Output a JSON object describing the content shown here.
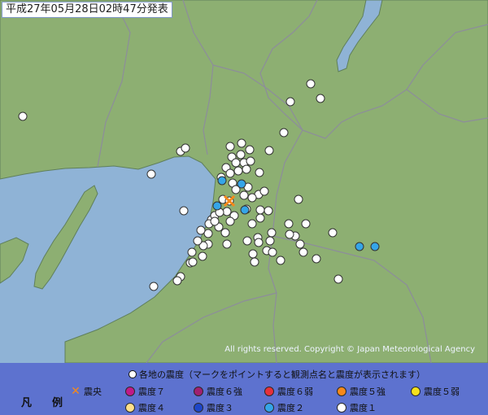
{
  "title": "平成27年05月28日02時47分発表",
  "copyright": "All rights reserved. Copyright © Japan Meteorological Agency",
  "colors": {
    "sea": "#8fb3d6",
    "land": "#8daf72",
    "border": "#8d8d9b",
    "coast": "#5f7f5c",
    "legend_bg": "#5d72cf"
  },
  "legend": {
    "heading": "各地の震度（マークをポイントすると観測点名と震度が表示されます）",
    "title": "凡　例",
    "items": [
      {
        "label": "震央",
        "type": "epicenter",
        "color": "#f7891a"
      },
      {
        "label": "震度７",
        "type": "dot",
        "color": "#c01a88"
      },
      {
        "label": "震度６強",
        "type": "dot",
        "color": "#a02070"
      },
      {
        "label": "震度６弱",
        "type": "dot",
        "color": "#e6303a"
      },
      {
        "label": "震度５強",
        "type": "dot",
        "color": "#f7891a"
      },
      {
        "label": "震度５弱",
        "type": "dot",
        "color": "#f6e11b"
      },
      {
        "label": "震度４",
        "type": "dot",
        "color": "#ffe08a"
      },
      {
        "label": "震度３",
        "type": "dot",
        "color": "#1e46c8"
      },
      {
        "label": "震度２",
        "type": "dot",
        "color": "#35a5e8"
      },
      {
        "label": "震度１",
        "type": "dot",
        "color": "#ffffff"
      }
    ]
  },
  "observations": {
    "intensity2": 6,
    "intensity1": 90
  }
}
